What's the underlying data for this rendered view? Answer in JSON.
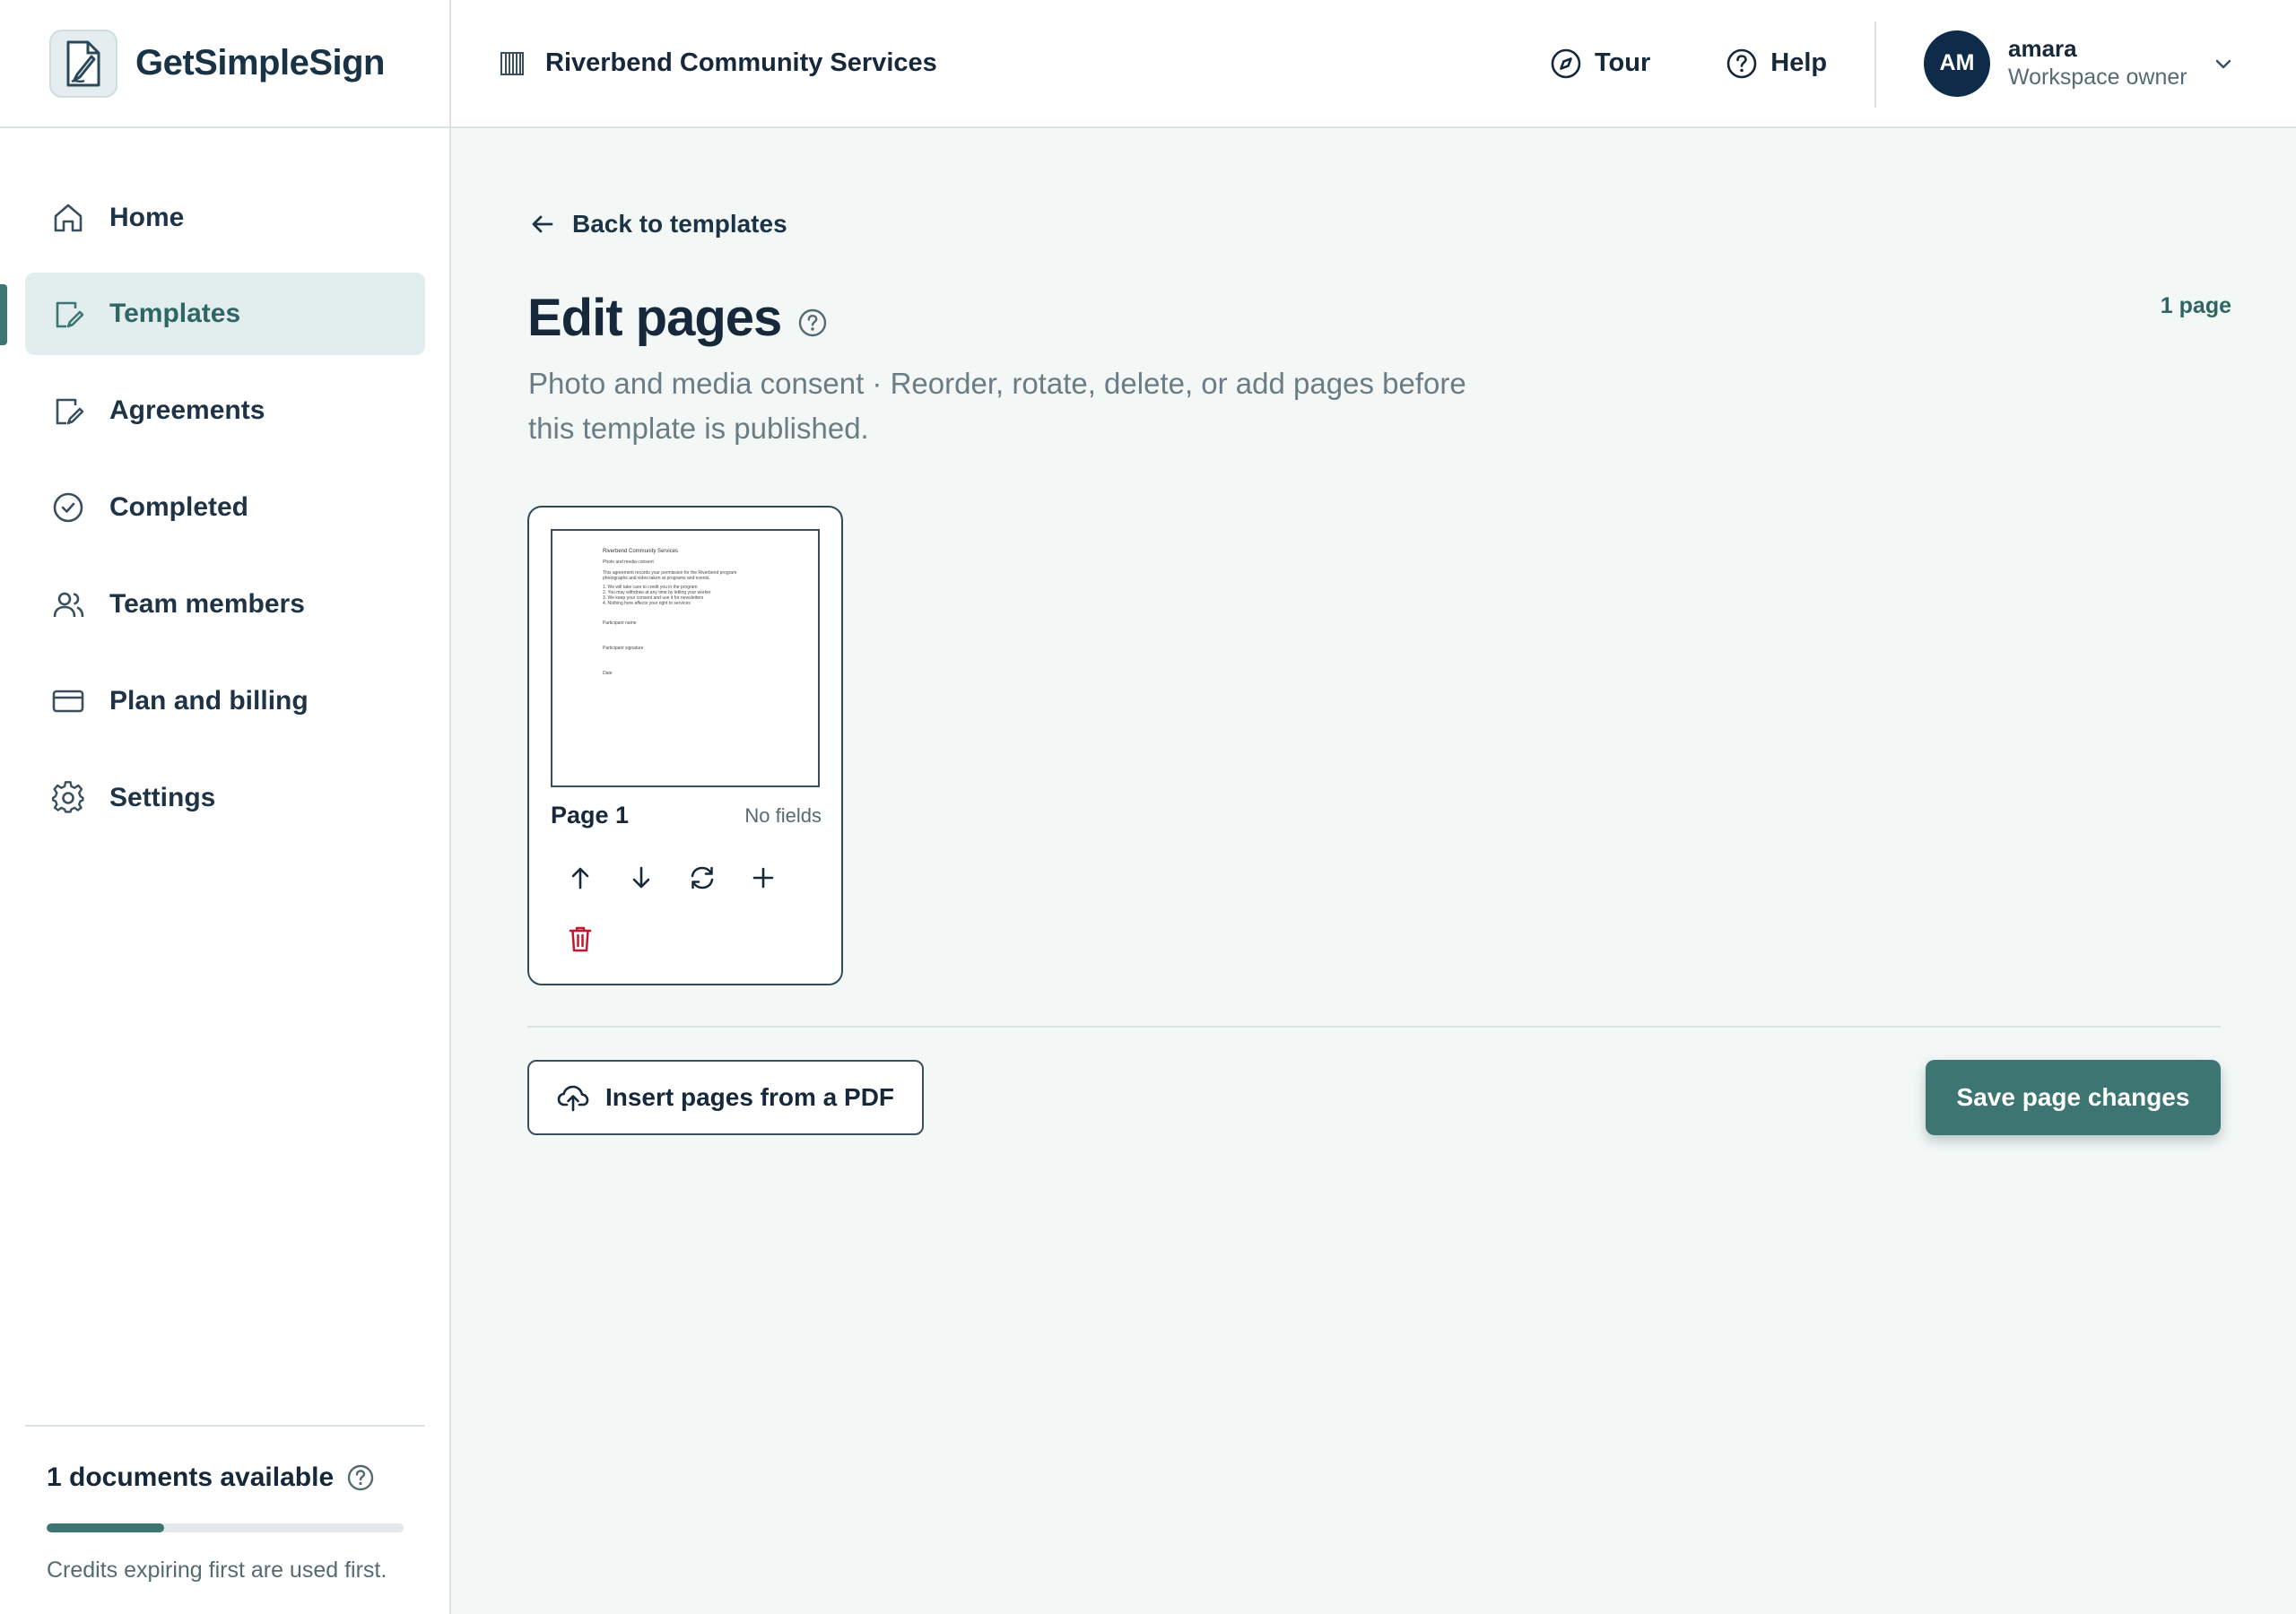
{
  "app": {
    "name": "GetSimpleSign",
    "organization": "Riverbend Community Services"
  },
  "header": {
    "tour_label": "Tour",
    "help_label": "Help",
    "user": {
      "initials": "AM",
      "name": "amara",
      "role": "Workspace owner"
    }
  },
  "sidebar": {
    "items": [
      {
        "label": "Home",
        "icon": "home-icon"
      },
      {
        "label": "Templates",
        "icon": "template-edit-icon",
        "active": true
      },
      {
        "label": "Agreements",
        "icon": "agreement-icon"
      },
      {
        "label": "Completed",
        "icon": "check-circle-icon"
      },
      {
        "label": "Team members",
        "icon": "users-icon"
      },
      {
        "label": "Plan and billing",
        "icon": "credit-card-icon"
      },
      {
        "label": "Settings",
        "icon": "gear-icon"
      }
    ],
    "credits": {
      "title": "1 documents available",
      "progress_fraction": 0.33,
      "note": "Credits expiring first are used first."
    }
  },
  "main": {
    "back_label": "Back to templates",
    "title": "Edit pages",
    "page_count": "1 page",
    "subtitle": "Photo and media consent · Reorder, rotate, delete, or add pages before this template is published.",
    "pages": [
      {
        "label": "Page 1",
        "fields": "No fields",
        "thumbnail": {
          "heading": "Riverbend Community Services",
          "subheading": "Photo and media consent",
          "intro": [
            "This agreement records your permission for the Riverbend program",
            "photographs and video taken at programs and events."
          ],
          "items": [
            "1. We will take care to credit you in the program",
            "2. You may withdraw at any time by letting your worker",
            "3. We keep your consent and use it for newsletters",
            "4. Nothing here affects your right to services"
          ],
          "fields": [
            "Participant name",
            "Participant signature",
            "Date"
          ]
        }
      }
    ],
    "insert_label": "Insert pages from a PDF",
    "save_label": "Save page changes"
  },
  "colors": {
    "accent": "#3d7572",
    "navy": "#0f2b4a",
    "danger": "#c0182f",
    "background": "#f3f8f7"
  }
}
